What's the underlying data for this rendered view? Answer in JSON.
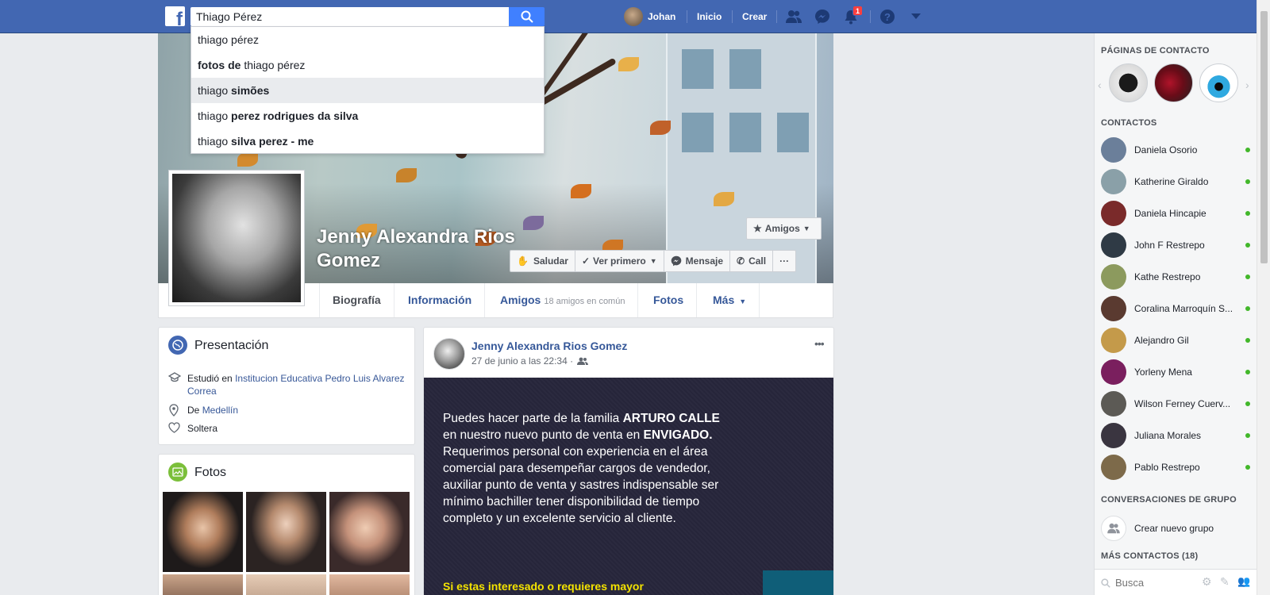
{
  "topbar": {
    "logo": "f",
    "search_value": "Thiago Pérez",
    "user_name": "Johan",
    "home": "Inicio",
    "create": "Crear",
    "notif_count": "1",
    "icons": [
      "friends-icon",
      "messenger-icon",
      "notifications-icon",
      "help-icon",
      "account-menu-icon"
    ]
  },
  "search_suggestions": [
    {
      "plain": "thiago pérez",
      "bold": ""
    },
    {
      "plain_before": "",
      "bold_before": "fotos de",
      "plain": "thiago pérez"
    },
    {
      "plain": "thiago",
      "bold": "simões"
    },
    {
      "plain": "thiago",
      "bold": "perez rodrigues da silva"
    },
    {
      "plain": "thiago",
      "bold": "silva perez - me"
    }
  ],
  "profile": {
    "name": "Jenny Alexandra Rios Gomez",
    "friends_button": "Amigos",
    "actions": [
      "Saludar",
      "Ver primero",
      "Mensaje",
      "Call",
      "···"
    ]
  },
  "tabs": {
    "biografia": "Biografía",
    "informacion": "Información",
    "amigos": "Amigos",
    "amigos_common": "18 amigos en común",
    "fotos": "Fotos",
    "mas": "Más"
  },
  "intro": {
    "title": "Presentación",
    "studied_prefix": "Estudió en",
    "school": "Institucion Educativa Pedro Luis Alvarez Correa",
    "from_prefix": "De",
    "city": "Medellín",
    "status": "Soltera"
  },
  "photos_card": {
    "title": "Fotos"
  },
  "post": {
    "author": "Jenny Alexandra Rios Gomez",
    "date": "27 de junio a las 22:34 ·",
    "menu": "•••",
    "text_1a": "Puedes hacer parte de la familia ",
    "text_1b": "ARTURO CALLE",
    "text_1c": " en nuestro nuevo punto de venta en ",
    "text_1d": "ENVIGADO.",
    "text_2": "Requerimos personal con experiencia en el área comercial para desempeñar cargos de vendedor, auxiliar punto de venta y sastres indispensable ser mínimo bachiller tener disponibilidad de tiempo completo y  un excelente servicio al cliente.",
    "text_yellow": "Si estas interesado o requieres mayor"
  },
  "sidebar": {
    "pages_heading": "PÁGINAS DE CONTACTO",
    "contacts_heading": "CONTACTOS",
    "contacts": [
      {
        "name": "Daniela Osorio",
        "color": "#6b7f9a"
      },
      {
        "name": "Katherine Giraldo",
        "color": "#8aa0a8"
      },
      {
        "name": "Daniela Hincapie",
        "color": "#7a2a2a"
      },
      {
        "name": "John F Restrepo",
        "color": "#2f3a45"
      },
      {
        "name": "Kathe Restrepo",
        "color": "#8c9a5e"
      },
      {
        "name": "Coralina Marroquín S...",
        "color": "#5a3a30"
      },
      {
        "name": "Alejandro Gil",
        "color": "#c49a4a"
      },
      {
        "name": "Yorleny Mena",
        "color": "#7a1f5e"
      },
      {
        "name": "Wilson Ferney Cuerv...",
        "color": "#5c5a55"
      },
      {
        "name": "Juliana Morales",
        "color": "#3a3540"
      },
      {
        "name": "Pablo Restrepo",
        "color": "#7d6a4a"
      }
    ],
    "groups_heading": "CONVERSACIONES DE GRUPO",
    "create_group": "Crear nuevo grupo",
    "more_contacts": "MÁS CONTACTOS (18)",
    "search_placeholder": "Busca"
  },
  "colors": {
    "brand": "#4267b2",
    "link": "#365899",
    "online": "#42b72a",
    "badge": "#fa3e3e"
  }
}
